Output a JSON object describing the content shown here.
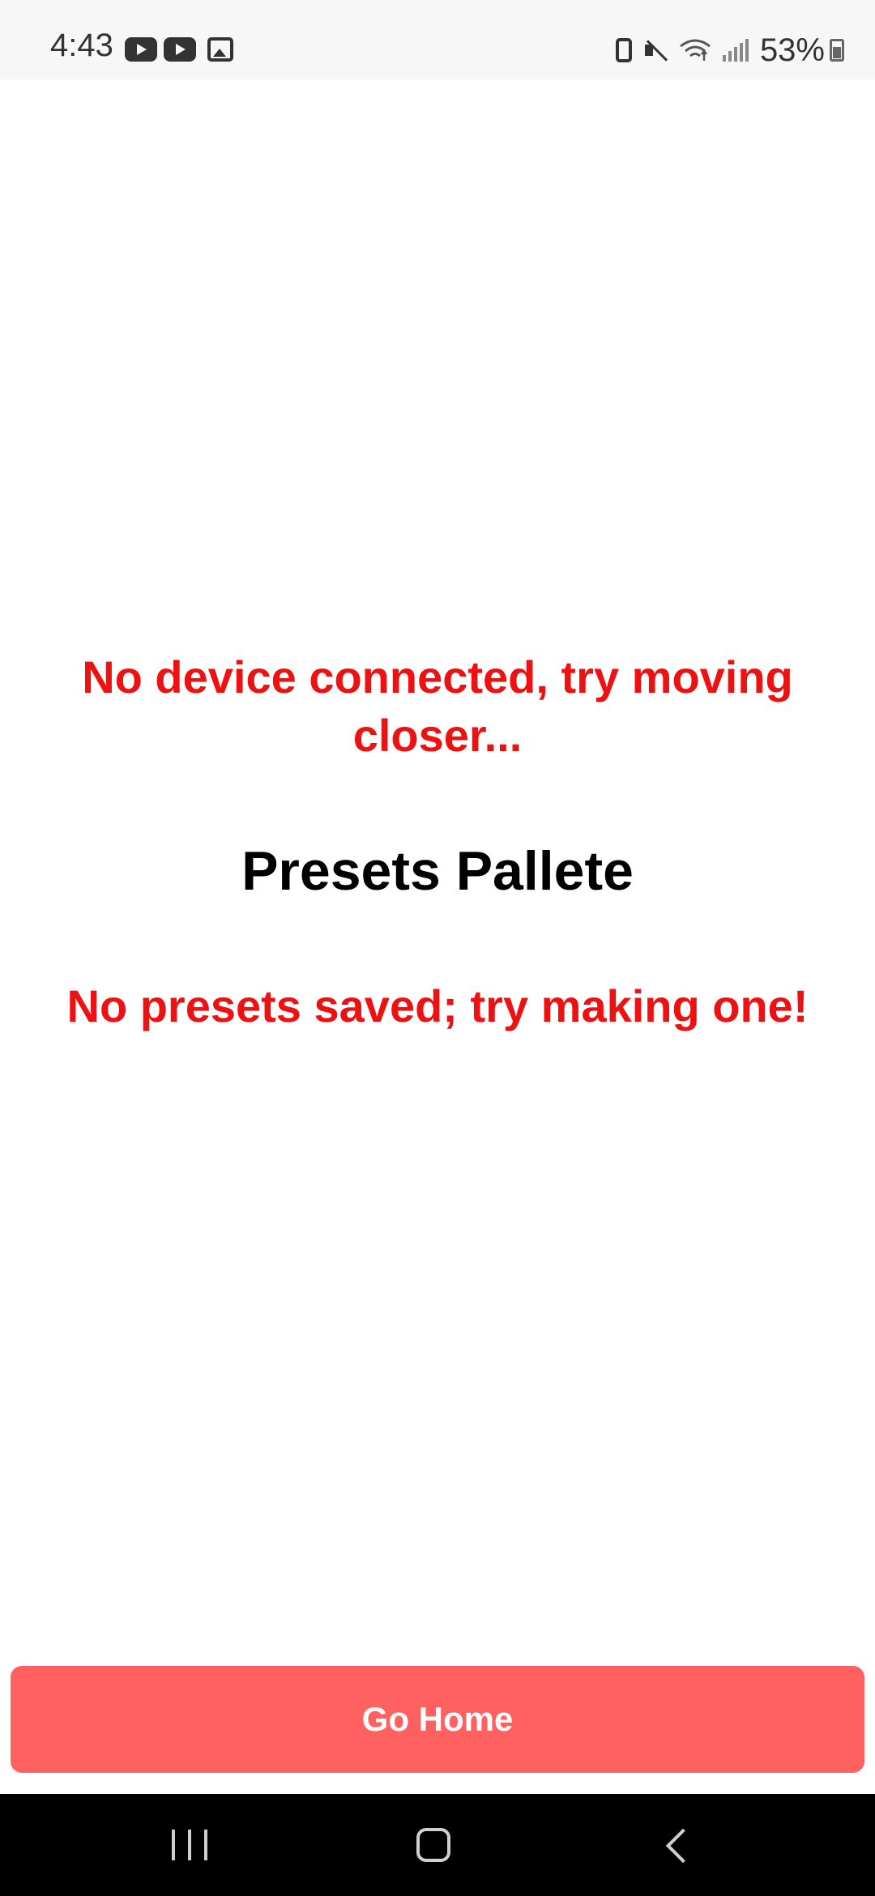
{
  "status_bar": {
    "time": "4:43",
    "battery_percent": "53%",
    "left_icons": [
      "youtube-icon",
      "youtube-icon",
      "gallery-icon"
    ],
    "right_icons": [
      "battery-saver-icon",
      "mute-icon",
      "wifi-icon",
      "signal-icon",
      "battery-icon"
    ]
  },
  "main": {
    "connection_message": "No device connected, try moving closer...",
    "title": "Presets Pallete",
    "empty_message": "No presets saved; try making one!"
  },
  "actions": {
    "go_home_label": "Go Home"
  },
  "colors": {
    "error_text": "#ee1111",
    "button_bg": "#ff6161",
    "button_text": "#ffffff",
    "nav_bar_bg": "#000000"
  },
  "nav_bar": {
    "buttons": [
      "recents-icon",
      "home-icon",
      "back-icon"
    ]
  }
}
